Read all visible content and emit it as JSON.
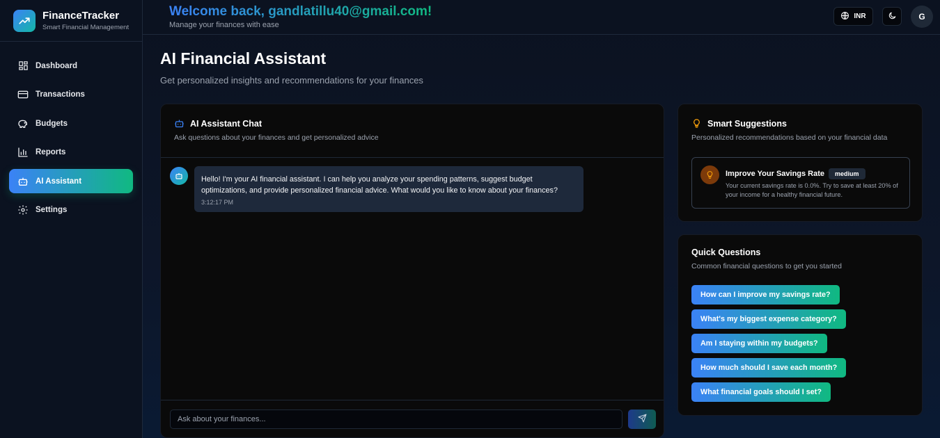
{
  "brand": {
    "title": "FinanceTracker",
    "subtitle": "Smart Financial Management"
  },
  "sidebar": {
    "items": [
      {
        "label": "Dashboard",
        "icon": "grid-icon",
        "active": false
      },
      {
        "label": "Transactions",
        "icon": "credit-card-icon",
        "active": false
      },
      {
        "label": "Budgets",
        "icon": "piggy-bank-icon",
        "active": false
      },
      {
        "label": "Reports",
        "icon": "bar-chart-icon",
        "active": false
      },
      {
        "label": "AI Assistant",
        "icon": "bot-icon",
        "active": true
      },
      {
        "label": "Settings",
        "icon": "gear-icon",
        "active": false
      }
    ]
  },
  "header": {
    "welcome": "Welcome back, gandlatillu40@gmail.com!",
    "subtitle": "Manage your finances with ease",
    "currency": "INR",
    "avatar_initial": "G"
  },
  "page": {
    "title": "AI Financial Assistant",
    "subtitle": "Get personalized insights and recommendations for your finances"
  },
  "chat": {
    "title": "AI Assistant Chat",
    "subtitle": "Ask questions about your finances and get personalized advice",
    "messages": [
      {
        "sender": "bot",
        "text": "Hello! I'm your AI financial assistant. I can help you analyze your spending patterns, suggest budget optimizations, and provide personalized financial advice. What would you like to know about your finances?",
        "time": "3:12:17 PM"
      }
    ],
    "input_placeholder": "Ask about your finances..."
  },
  "suggestions": {
    "title": "Smart Suggestions",
    "subtitle": "Personalized recommendations based on your financial data",
    "items": [
      {
        "title": "Improve Your Savings Rate",
        "priority": "medium",
        "description": "Your current savings rate is 0.0%. Try to save at least 20% of your income for a healthy financial future."
      }
    ]
  },
  "quick_questions": {
    "title": "Quick Questions",
    "subtitle": "Common financial questions to get you started",
    "items": [
      "How can I improve my savings rate?",
      "What's my biggest expense category?",
      "Am I staying within my budgets?",
      "How much should I save each month?",
      "What financial goals should I set?"
    ]
  },
  "colors": {
    "accent_start": "#3b82f6",
    "accent_end": "#10b981",
    "background": "#0b1220"
  }
}
